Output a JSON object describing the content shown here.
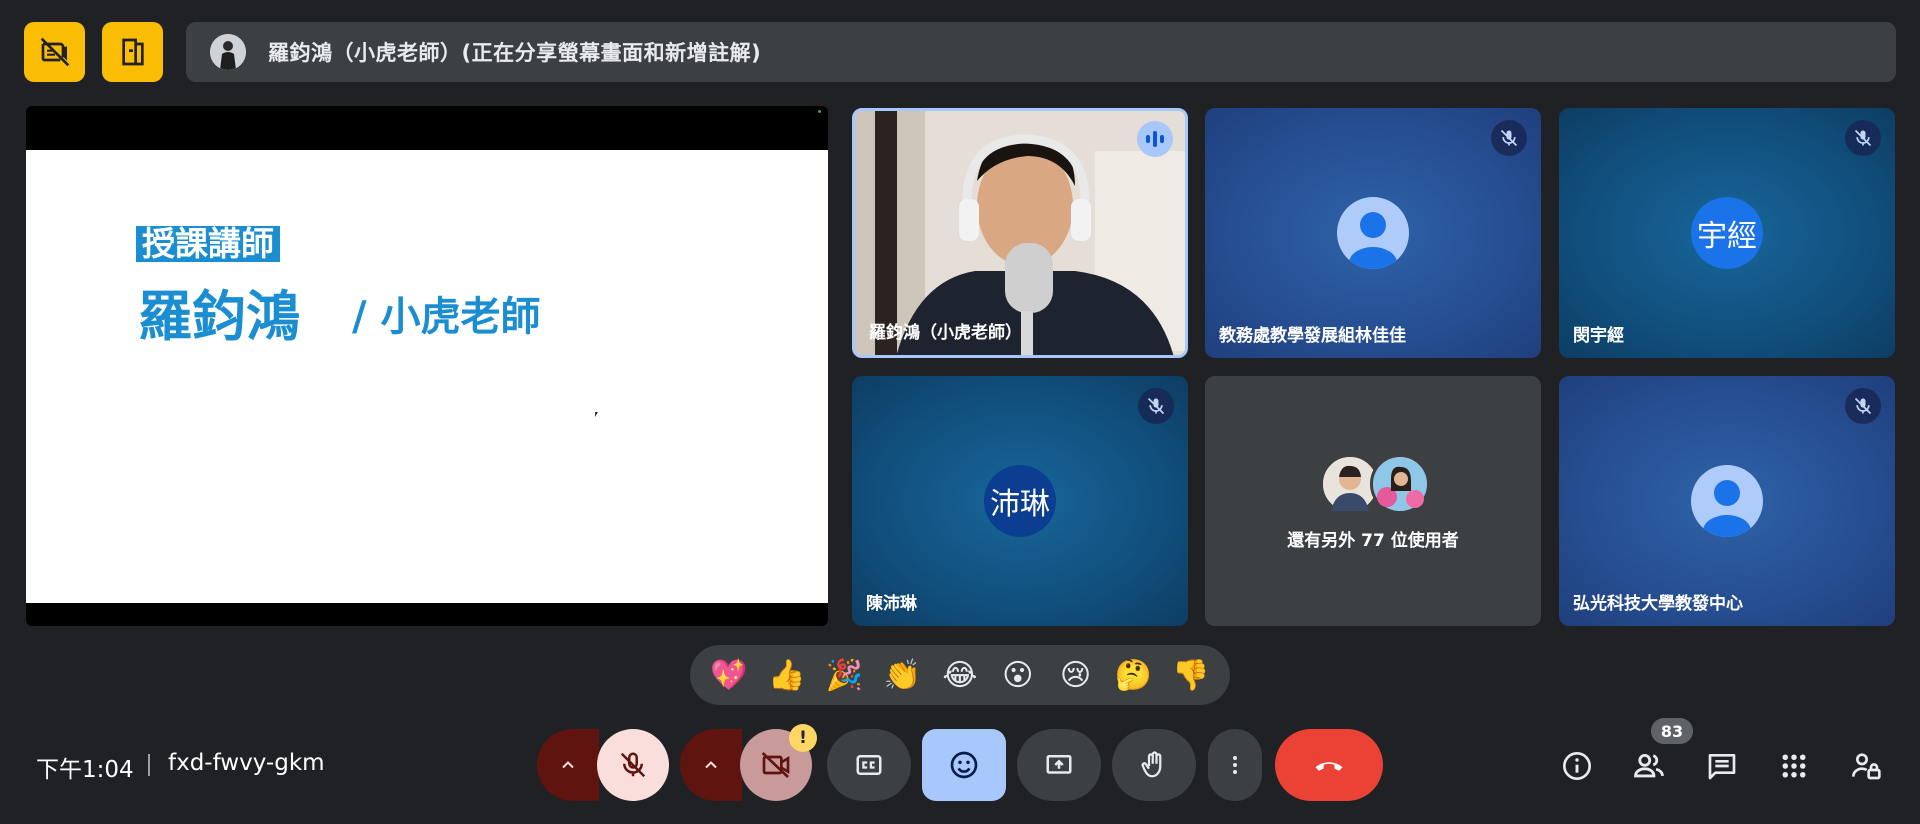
{
  "presenter_bar": {
    "text": "羅鈞鴻（小虎老師）(正在分享螢幕畫面和新增註解)"
  },
  "slide": {
    "tag": "授課講師",
    "name": "羅鈞鴻",
    "sub": "/ 小虎老師"
  },
  "tiles": [
    {
      "name": "羅鈞鴻（小虎老師）",
      "state": "speaking"
    },
    {
      "name": "教務處教學發展組林佳佳",
      "state": "muted"
    },
    {
      "name": "閔宇經",
      "initials": "宇經",
      "state": "muted"
    },
    {
      "name": "陳沛琳",
      "initials": "沛琳",
      "state": "muted"
    },
    {
      "more_text": "還有另外 77 位使用者"
    },
    {
      "name": "弘光科技大學教發中心",
      "state": "muted"
    }
  ],
  "reactions": [
    "💖",
    "👍",
    "🎉",
    "👏",
    "😂",
    "😮",
    "😢",
    "🤔",
    "👎"
  ],
  "meeting": {
    "time": "下午1:04",
    "code": "fxd-fwvy-gkm"
  },
  "badges": {
    "warning": "!",
    "participants": "83"
  },
  "colors": {
    "accent_yellow": "#fbbc04",
    "end_call": "#ea4335",
    "mic_off_bg": "#f9dedc",
    "active_blue": "#a8c7fa",
    "dark_red": "#601410"
  },
  "icons": [
    "hide-tile-icon",
    "present-icon",
    "mic-off-icon",
    "cam-off-icon",
    "captions-icon",
    "emoji-icon",
    "present-now-icon",
    "raise-hand-icon",
    "more-options-icon",
    "end-call-icon",
    "info-icon",
    "people-icon",
    "chat-icon",
    "activities-icon",
    "host-controls-icon"
  ]
}
